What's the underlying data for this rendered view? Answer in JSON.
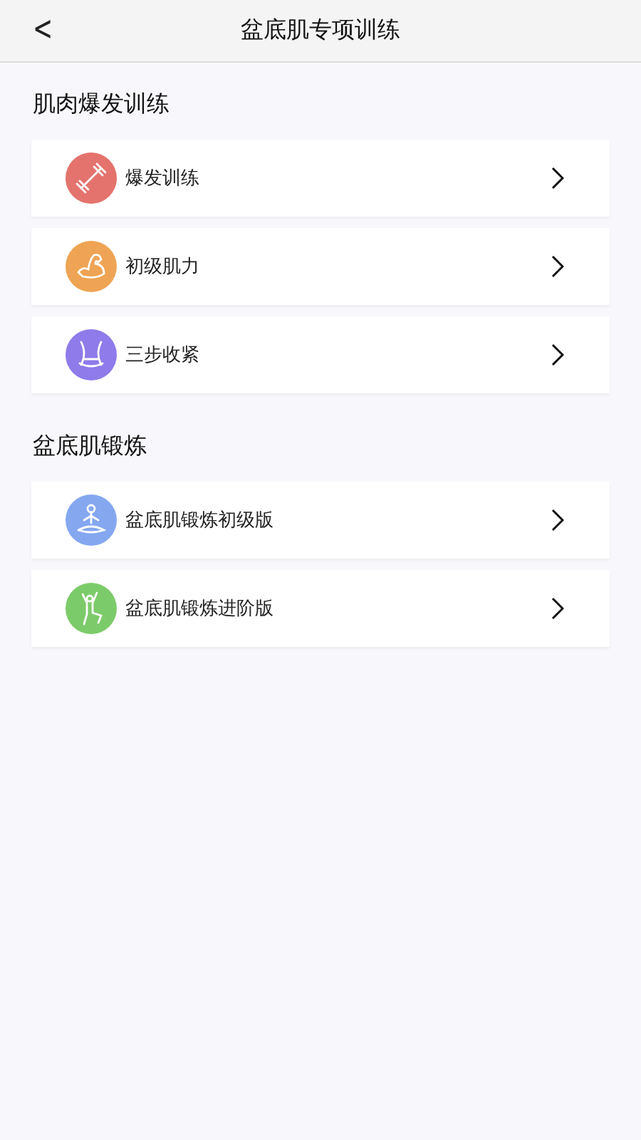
{
  "header": {
    "back": "<",
    "title": "盆底肌专项训练"
  },
  "sections": [
    {
      "title": "肌肉爆发训练",
      "items": [
        {
          "label": "爆发训练",
          "kind": "dumbbell",
          "color": "#e4736d"
        },
        {
          "label": "初级肌力",
          "kind": "arm",
          "color": "#eea454"
        },
        {
          "label": "三步收紧",
          "kind": "waist",
          "color": "#8f7bea"
        }
      ]
    },
    {
      "title": "盆底肌锻炼",
      "items": [
        {
          "label": "盆底肌锻炼初级版",
          "kind": "meditate",
          "color": "#84a7f0"
        },
        {
          "label": "盆底肌锻炼进阶版",
          "kind": "stretch",
          "color": "#7ccb6a"
        }
      ]
    }
  ]
}
